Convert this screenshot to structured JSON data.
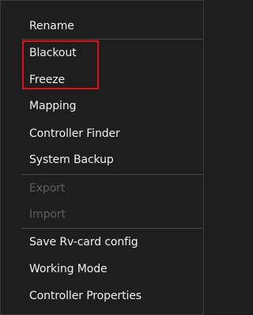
{
  "menu": {
    "items": [
      {
        "label": "Rename",
        "enabled": true
      },
      {
        "label": "Blackout",
        "enabled": true
      },
      {
        "label": "Freeze",
        "enabled": true
      },
      {
        "label": "Mapping",
        "enabled": true
      },
      {
        "label": "Controller Finder",
        "enabled": true
      },
      {
        "label": "System Backup",
        "enabled": true
      },
      {
        "label": "Export",
        "enabled": false
      },
      {
        "label": "Import",
        "enabled": false
      },
      {
        "label": "Save Rv-card config",
        "enabled": true
      },
      {
        "label": "Working Mode",
        "enabled": true
      },
      {
        "label": "Controller Properties",
        "enabled": true
      }
    ]
  },
  "colors": {
    "background": "#1e1e1e",
    "text": "#f0f0f0",
    "disabled_text": "#5e5e5e",
    "highlight_box": "#e0101a",
    "separator": "#4a4a4a"
  }
}
